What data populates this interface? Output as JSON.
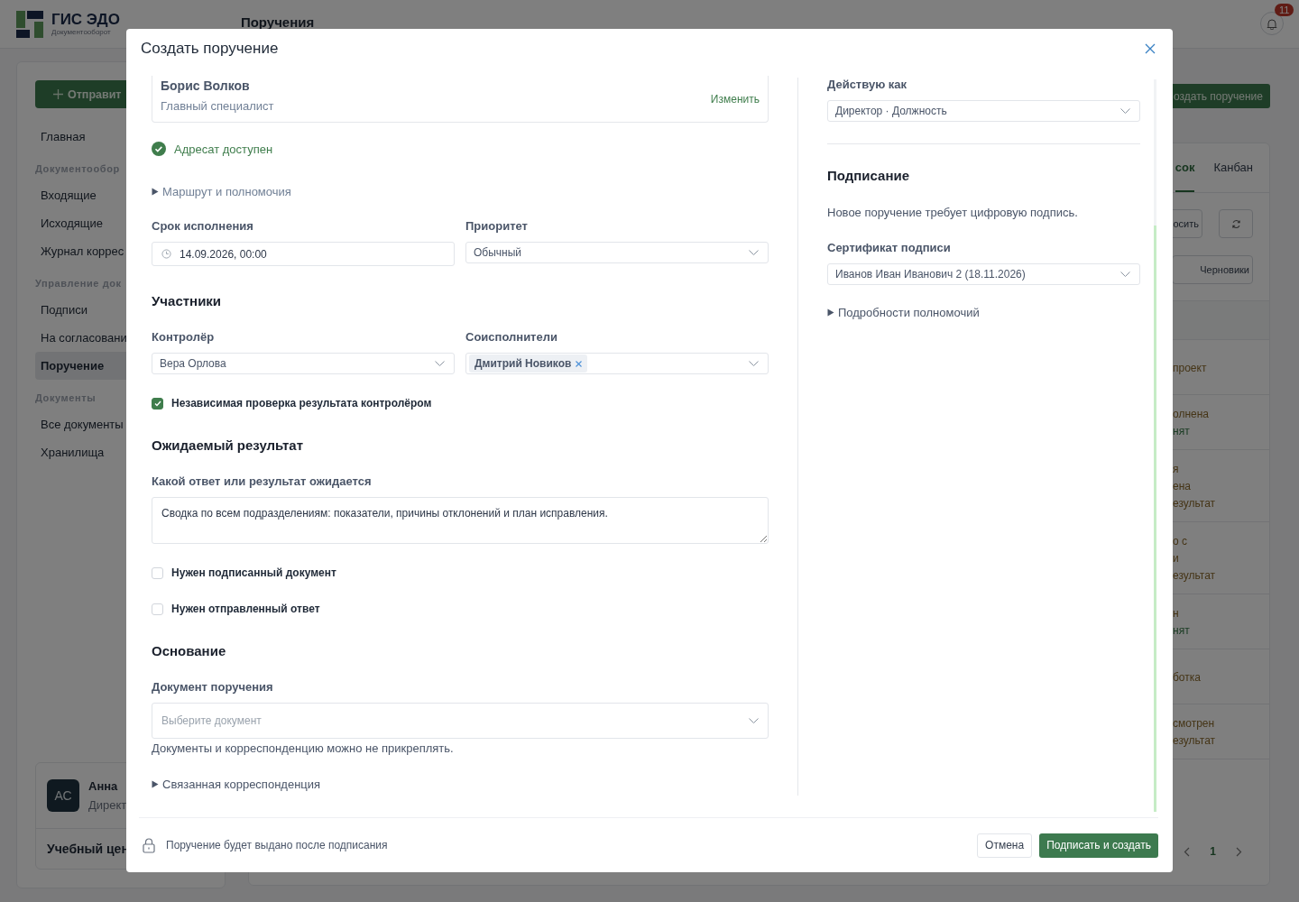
{
  "app": {
    "logo_title": "ГИС ЭДО",
    "logo_subtitle": "Документооборот",
    "page_title": "Поручения",
    "notification_count": "11"
  },
  "sidebar": {
    "primary_button": "Отправит",
    "sections": [
      {
        "items": [
          {
            "label": "Главная",
            "selected": false
          }
        ]
      },
      {
        "heading": "Документообор",
        "items": [
          {
            "label": "Входящие",
            "selected": false
          },
          {
            "label": "Исходящие",
            "selected": false
          },
          {
            "label": "Журнал коррес",
            "selected": false
          }
        ]
      },
      {
        "heading": "Управление док",
        "items": [
          {
            "label": "Подписи",
            "selected": false
          },
          {
            "label": "На согласовани",
            "selected": false
          },
          {
            "label": "Поручение",
            "selected": true
          }
        ]
      },
      {
        "heading": "Документы",
        "items": [
          {
            "label": "Все документы",
            "selected": false
          },
          {
            "label": "Хранилища",
            "selected": false
          }
        ]
      }
    ],
    "user": {
      "initials": "АС",
      "name": "Анна",
      "role": "Директ",
      "organization": "Учебный цен"
    }
  },
  "main": {
    "create_button": "оздать поручение",
    "tabs": [
      {
        "label": "сок",
        "selected": true
      },
      {
        "label": "Канбан",
        "selected": false
      }
    ],
    "toolbar_rows": [
      [
        {
          "kind": "text",
          "label": "осить"
        },
        {
          "kind": "refresh"
        }
      ],
      [
        {
          "kind": "text",
          "label": "Черновики"
        }
      ]
    ],
    "rows": [
      {
        "lines": [
          {
            "text": "проект",
            "kind": "warning"
          }
        ]
      },
      {
        "lines": [
          {
            "text": "олнена",
            "kind": "warning"
          },
          {
            "text": "нят",
            "kind": "success"
          }
        ]
      },
      {
        "lines": [
          {
            "text": "я",
            "kind": "warning"
          },
          {
            "text": "ена",
            "kind": "warning"
          },
          {
            "text": "езультат",
            "kind": "warning"
          }
        ]
      },
      {
        "lines": [
          {
            "text": "о с",
            "kind": "warning"
          },
          {
            "text": "и",
            "kind": "warning"
          },
          {
            "text": "езультат",
            "kind": "warning"
          }
        ]
      },
      {
        "lines": [
          {
            "text": "н",
            "kind": "warning"
          },
          {
            "text": "нят",
            "kind": "success"
          }
        ]
      },
      {
        "lines": [
          {
            "text": "ботка",
            "kind": "warning"
          }
        ]
      },
      {
        "lines": [
          {
            "text": "смотрен",
            "kind": "warning"
          },
          {
            "text": "езультат",
            "kind": "warning"
          }
        ]
      }
    ],
    "pagination": {
      "current": "1"
    }
  },
  "modal": {
    "title": "Создать поручение",
    "columns": [
      {
        "blocks": [
          {
            "kind": "recipient",
            "name": "Борис Волков",
            "role": "Главный специалист",
            "action": "Изменить"
          },
          {
            "kind": "status",
            "text": "Адресат доступен"
          },
          {
            "kind": "disclosure",
            "text": "Маршрут и полномочия"
          },
          {
            "kind": "fields",
            "fields": [
              {
                "kind": "date",
                "label": "Срок исполнения",
                "value": "14.09.2026, 00:00"
              },
              {
                "kind": "select",
                "label": "Приоритет",
                "value": "Обычный"
              }
            ]
          },
          {
            "kind": "section",
            "text": "Участники"
          },
          {
            "kind": "fields",
            "fields": [
              {
                "kind": "select",
                "label": "Контролёр",
                "value": "Вера Орлова"
              },
              {
                "kind": "multiselect",
                "label": "Соисполнители",
                "chips": [
                  "Дмитрий Новиков"
                ]
              }
            ]
          },
          {
            "kind": "checkbox",
            "text": "Независимая проверка результата контролёром",
            "checked": true
          },
          {
            "kind": "section",
            "text": "Ожидаемый результат"
          },
          {
            "kind": "fields",
            "fields": [
              {
                "kind": "textarea",
                "label": "Какой ответ или результат ожидается",
                "value": "Сводка по всем подразделениям: показатели, причины отклонений и план исправления."
              }
            ]
          },
          {
            "kind": "checkbox",
            "text": "Нужен подписанный документ",
            "checked": false
          },
          {
            "kind": "checkbox",
            "text": "Нужен отправленный ответ",
            "checked": false
          },
          {
            "kind": "section",
            "text": "Основание"
          },
          {
            "kind": "fields",
            "fields": [
              {
                "kind": "picker",
                "label": "Документ поручения",
                "placeholder": "Выберите документ"
              }
            ]
          },
          {
            "kind": "hint",
            "text": "Документы и корреспонденцию можно не прикреплять."
          },
          {
            "kind": "disclosure",
            "text": "Связанная корреспонденция"
          }
        ]
      },
      {
        "blocks": [
          {
            "kind": "fields",
            "fields": [
              {
                "kind": "select",
                "label": "Действую как",
                "value": "Директор · Должность"
              }
            ]
          },
          {
            "kind": "divider"
          },
          {
            "kind": "section",
            "text": "Подписание"
          },
          {
            "kind": "text",
            "text": "Новое поручение требует цифровую подпись."
          },
          {
            "kind": "fields",
            "fields": [
              {
                "kind": "select",
                "label": "Сертификат подписи",
                "value": "Иванов Иван Иванович 2 (18.11.2026)"
              }
            ]
          },
          {
            "kind": "disclosure",
            "text": "Подробности полномочий"
          }
        ]
      }
    ],
    "footer": {
      "note": "Поручение будет выдано после подписания",
      "cancel": "Отмена",
      "submit": "Подписать и создать"
    }
  }
}
